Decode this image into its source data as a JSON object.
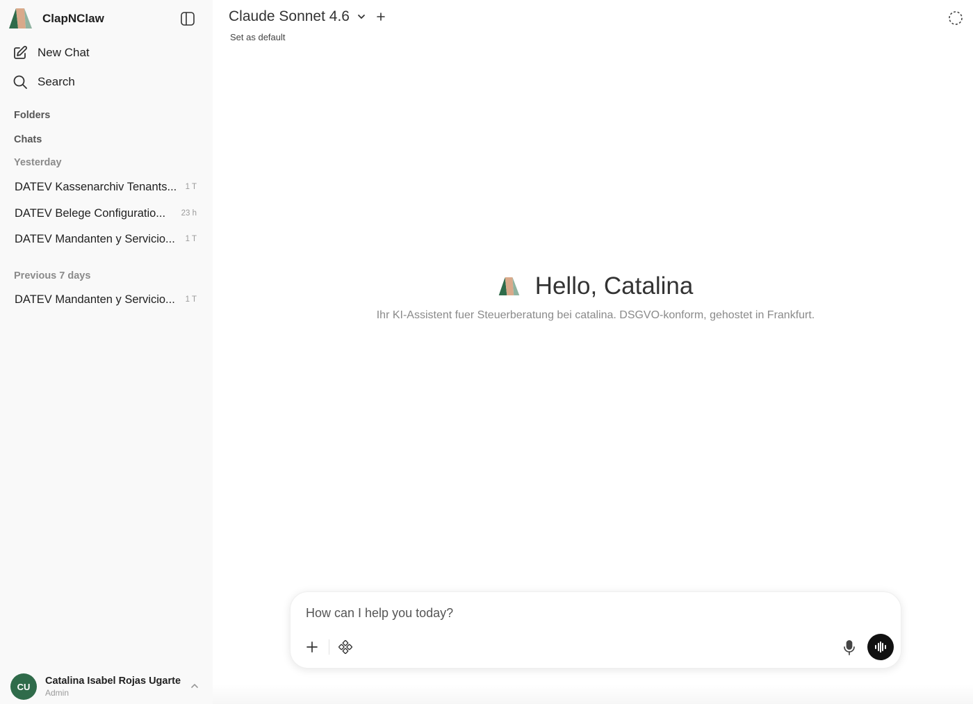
{
  "app": {
    "name": "ClapNClaw"
  },
  "sidebar": {
    "new_chat_label": "New Chat",
    "search_label": "Search",
    "folders_label": "Folders",
    "chats_label": "Chats",
    "groups": [
      {
        "label": "Yesterday",
        "chats": [
          {
            "title": "DATEV Kassenarchiv Tenants...",
            "age": "1 T"
          },
          {
            "title": "DATEV Belege Configuratio...",
            "age": "23 h"
          },
          {
            "title": "DATEV Mandanten y Servicio...",
            "age": "1 T"
          }
        ]
      },
      {
        "label": "Previous 7 days",
        "chats": [
          {
            "title": "DATEV Mandanten y Servicio...",
            "age": "1 T"
          }
        ]
      }
    ]
  },
  "user": {
    "initials": "CU",
    "name": "Catalina Isabel Rojas Ugarte",
    "role": "Admin"
  },
  "header": {
    "model_name": "Claude Sonnet 4.6",
    "set_default_label": "Set as default"
  },
  "welcome": {
    "greeting": "Hello, Catalina",
    "subtitle": "Ihr KI-Assistent fuer Steuerberatung bei catalina. DSGVO-konform, gehostet in Frankfurt."
  },
  "composer": {
    "placeholder": "How can I help you today?"
  },
  "icons": {
    "logo": "brand-logo-icon",
    "sidebar_toggle": "sidebar-toggle-icon",
    "new_chat": "pencil-square-icon",
    "search": "search-icon",
    "model_dropdown": "chevron-down-icon",
    "model_add": "plus-icon",
    "temporary_chat": "dashed-circle-icon",
    "attach": "plus-icon",
    "tools": "tools-icon",
    "mic": "mic-icon",
    "voice_mode": "waveform-icon",
    "user_menu": "chevron-up-icon"
  },
  "colors": {
    "sidebar_bg": "#f9f9f9",
    "avatar_bg": "#2f6b4a",
    "logo_dark_green": "#2f6b4a",
    "logo_tan": "#d9a98a",
    "logo_sage": "#8fb3a0",
    "voice_button_bg": "#111111"
  }
}
